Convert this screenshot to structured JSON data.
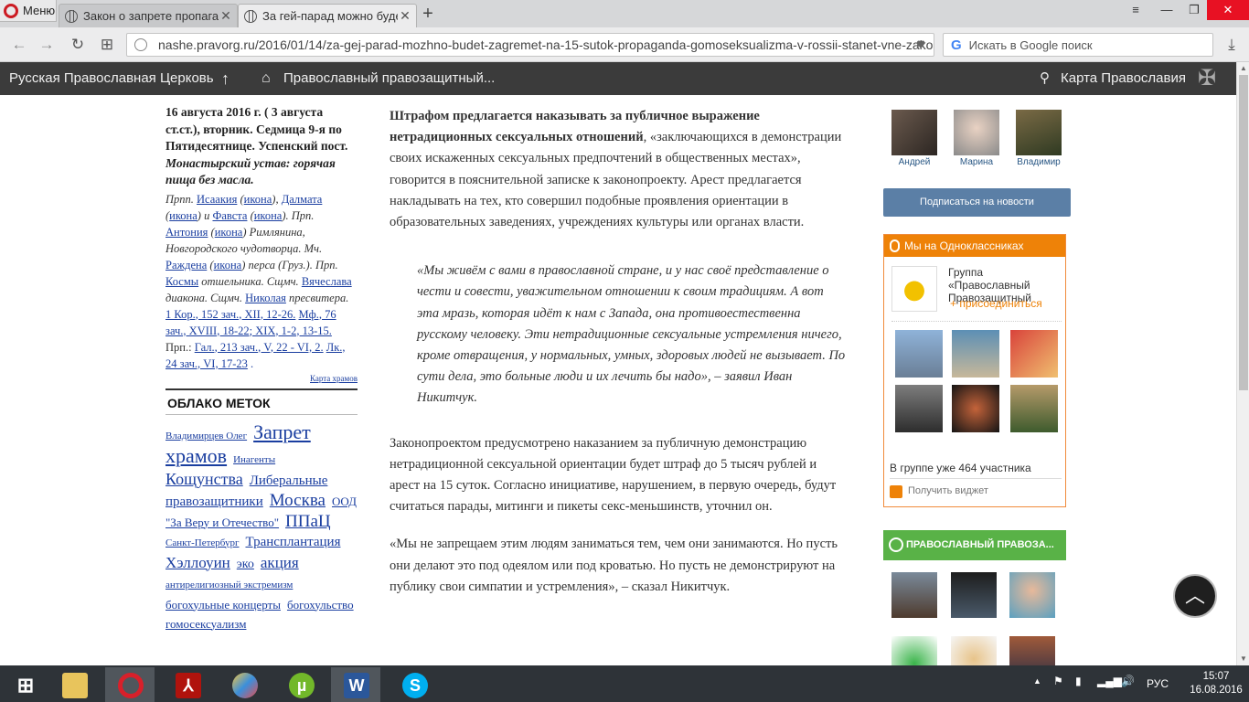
{
  "browser": {
    "menu_label": "Меню",
    "tabs": [
      {
        "title": "Закон о запрете пропага"
      },
      {
        "title": "За гей-парад можно буде"
      }
    ],
    "new_tab": "+",
    "url": "nashe.pravorg.ru/2016/01/14/za-gej-parad-mozhno-budet-zagremet-na-15-sutok-propaganda-gomoseksualizma-v-rossii-stanet-vne-zakona",
    "search_placeholder": "Искать в Google поиск"
  },
  "sitenav": {
    "item1": "Русская Православная Церковь",
    "item2": "Православный правозащитный...",
    "item3": "Карта Православия"
  },
  "calendar": {
    "date_line": "16 августа 2016 г. ( 3 августа ст.ст.), вторник.",
    "week_line": "Седмица 9-я по Пятидесятнице. Успенский пост.",
    "rule_line": "Монастырский устав: горячая пища без масла.",
    "saints": {
      "p1": "Прпп.",
      "isaakiy": "Исаакия",
      "icon": "икона",
      "dalmat": "Далмата",
      "and": "и",
      "favst": "Фавста",
      "p2": "Прп.",
      "antoniy": "Антония",
      "antoniy_rest": "Римлянина, Новгородского чудотворца. Мч.",
      "razhden": "Раждена",
      "razhden_rest": "перса (Груз.).",
      "p3": "Прп.",
      "kosma": "Космы",
      "kosma_rest": "отшельника. Сщмч.",
      "vyacheslav": "Вячеслава",
      "vyacheslav_rest": "диакона. Сщмч.",
      "nikolay": "Николая",
      "nikolay_rest": "пресвитера."
    },
    "readings": {
      "r1": "1 Кор., 152 зач., XII, 12-26.",
      "r2": "Мф., 76 зач., XVIII, 18-22; XIX, 1-2, 13-15.",
      "r3_pre": "Прп.:",
      "r3": "Гал., 213 зач., V, 22 - VI, 2.",
      "r4": "Лк., 24 зач., VI, 17-23"
    },
    "map_link": "Карта храмов"
  },
  "tag_cloud": {
    "heading": "ОБЛАКО МЕТОК",
    "tags": [
      {
        "text": "Владимирцев Олег",
        "size": 11
      },
      {
        "text": "Запрет храмов",
        "size": 22
      },
      {
        "text": "Инагенты",
        "size": 11
      },
      {
        "text": "Кощунства",
        "size": 18
      },
      {
        "text": "Либеральные правозащитники",
        "size": 15
      },
      {
        "text": "Москва",
        "size": 19
      },
      {
        "text": "ООД \"За Веру и Отечество\"",
        "size": 13
      },
      {
        "text": "ППаЦ",
        "size": 19
      },
      {
        "text": "Санкт-Петербург",
        "size": 11
      },
      {
        "text": "Трансплантация",
        "size": 15
      },
      {
        "text": "Хэллоуин",
        "size": 17
      },
      {
        "text": "эко",
        "size": 14
      },
      {
        "text": "акция",
        "size": 17
      },
      {
        "text": "антирелигиозный экстремизм",
        "size": 11
      },
      {
        "text": "богохульные концерты",
        "size": 13
      },
      {
        "text": "богохульство",
        "size": 13
      },
      {
        "text": "гомосексуализм",
        "size": 13
      }
    ]
  },
  "article": {
    "p1_bold": "Штрафом предлагается наказывать за публичное выражение нетрадиционных сексуальных отношений",
    "p1_rest": ", «заключающихся в демонстрации своих искаженных сексуальных предпочтений в общественных местах», говорится в пояснительной записке к законопроекту. Арест предлагается накладывать на тех, кто совершил подобные проявления ориентации в образовательных заведениях, учреждениях культуры или органах власти.",
    "quote": "«Мы живём с вами в православной стране, и у нас своё представление о чести и совести, уважительном отношении к своим традициям. А вот эта мразь, которая идёт к нам с Запада, она противоестественна русскому человеку. Эти нетрадиционные сексуальные устремления ничего, кроме отвращения, у нормальных, умных, здоровых людей не вызывает. По сути дела, это больные люди и их лечить бы надо», – заявил Иван Никитчук.",
    "p2": "Законопроектом предусмотрено наказанием за публичную демонстрацию нетрадиционной сексуальной ориентации будет штраф до 5 тысяч рублей и арест на 15 суток. Согласно инициативе, нарушением, в первую очередь, будут считаться парады, митинги и пикеты секс-меньшинств, уточнил он.",
    "p3": "«Мы не запрещаем этим людям заниматься тем, чем они занимаются. Но пусть они делают это под одеялом или под кроватью. Но пусть не демонстрируют на публику свои симпатии и устремления», – сказал Никитчук."
  },
  "sidebar": {
    "friends": [
      "Андрей",
      "Марина",
      "Владимир"
    ],
    "vk_subscribe": "Подписаться на новости",
    "ok_title": "Мы на Одноклассниках",
    "ok_group": "Группа «Православный Правозащитный",
    "ok_join": "присоединиться",
    "ok_members": "В группе уже 464 участника",
    "ok_widget": "Получить виджет",
    "pz_title": "ПРАВОСЛАВНЫЙ ПРАВОЗА..."
  },
  "taskbar": {
    "lang": "РУС",
    "time": "15:07",
    "date": "16.08.2016"
  },
  "colors": {
    "sitenav_bg": "#3b3b3b",
    "vk_button": "#5b7fa6",
    "ok_orange": "#ee8208",
    "pz_green": "#59b247",
    "link_blue": "#1a3ea0"
  }
}
